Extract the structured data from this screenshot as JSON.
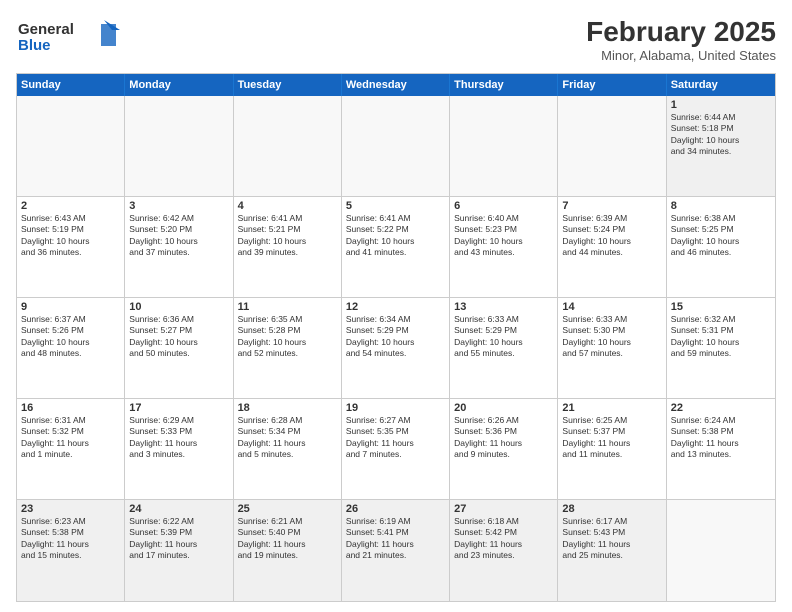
{
  "header": {
    "logo_line1": "General",
    "logo_line2": "Blue",
    "title": "February 2025",
    "subtitle": "Minor, Alabama, United States"
  },
  "days_of_week": [
    "Sunday",
    "Monday",
    "Tuesday",
    "Wednesday",
    "Thursday",
    "Friday",
    "Saturday"
  ],
  "weeks": [
    [
      {
        "day": "",
        "info": ""
      },
      {
        "day": "",
        "info": ""
      },
      {
        "day": "",
        "info": ""
      },
      {
        "day": "",
        "info": ""
      },
      {
        "day": "",
        "info": ""
      },
      {
        "day": "",
        "info": ""
      },
      {
        "day": "1",
        "info": "Sunrise: 6:44 AM\nSunset: 5:18 PM\nDaylight: 10 hours\nand 34 minutes."
      }
    ],
    [
      {
        "day": "2",
        "info": "Sunrise: 6:43 AM\nSunset: 5:19 PM\nDaylight: 10 hours\nand 36 minutes."
      },
      {
        "day": "3",
        "info": "Sunrise: 6:42 AM\nSunset: 5:20 PM\nDaylight: 10 hours\nand 37 minutes."
      },
      {
        "day": "4",
        "info": "Sunrise: 6:41 AM\nSunset: 5:21 PM\nDaylight: 10 hours\nand 39 minutes."
      },
      {
        "day": "5",
        "info": "Sunrise: 6:41 AM\nSunset: 5:22 PM\nDaylight: 10 hours\nand 41 minutes."
      },
      {
        "day": "6",
        "info": "Sunrise: 6:40 AM\nSunset: 5:23 PM\nDaylight: 10 hours\nand 43 minutes."
      },
      {
        "day": "7",
        "info": "Sunrise: 6:39 AM\nSunset: 5:24 PM\nDaylight: 10 hours\nand 44 minutes."
      },
      {
        "day": "8",
        "info": "Sunrise: 6:38 AM\nSunset: 5:25 PM\nDaylight: 10 hours\nand 46 minutes."
      }
    ],
    [
      {
        "day": "9",
        "info": "Sunrise: 6:37 AM\nSunset: 5:26 PM\nDaylight: 10 hours\nand 48 minutes."
      },
      {
        "day": "10",
        "info": "Sunrise: 6:36 AM\nSunset: 5:27 PM\nDaylight: 10 hours\nand 50 minutes."
      },
      {
        "day": "11",
        "info": "Sunrise: 6:35 AM\nSunset: 5:28 PM\nDaylight: 10 hours\nand 52 minutes."
      },
      {
        "day": "12",
        "info": "Sunrise: 6:34 AM\nSunset: 5:29 PM\nDaylight: 10 hours\nand 54 minutes."
      },
      {
        "day": "13",
        "info": "Sunrise: 6:33 AM\nSunset: 5:29 PM\nDaylight: 10 hours\nand 55 minutes."
      },
      {
        "day": "14",
        "info": "Sunrise: 6:33 AM\nSunset: 5:30 PM\nDaylight: 10 hours\nand 57 minutes."
      },
      {
        "day": "15",
        "info": "Sunrise: 6:32 AM\nSunset: 5:31 PM\nDaylight: 10 hours\nand 59 minutes."
      }
    ],
    [
      {
        "day": "16",
        "info": "Sunrise: 6:31 AM\nSunset: 5:32 PM\nDaylight: 11 hours\nand 1 minute."
      },
      {
        "day": "17",
        "info": "Sunrise: 6:29 AM\nSunset: 5:33 PM\nDaylight: 11 hours\nand 3 minutes."
      },
      {
        "day": "18",
        "info": "Sunrise: 6:28 AM\nSunset: 5:34 PM\nDaylight: 11 hours\nand 5 minutes."
      },
      {
        "day": "19",
        "info": "Sunrise: 6:27 AM\nSunset: 5:35 PM\nDaylight: 11 hours\nand 7 minutes."
      },
      {
        "day": "20",
        "info": "Sunrise: 6:26 AM\nSunset: 5:36 PM\nDaylight: 11 hours\nand 9 minutes."
      },
      {
        "day": "21",
        "info": "Sunrise: 6:25 AM\nSunset: 5:37 PM\nDaylight: 11 hours\nand 11 minutes."
      },
      {
        "day": "22",
        "info": "Sunrise: 6:24 AM\nSunset: 5:38 PM\nDaylight: 11 hours\nand 13 minutes."
      }
    ],
    [
      {
        "day": "23",
        "info": "Sunrise: 6:23 AM\nSunset: 5:38 PM\nDaylight: 11 hours\nand 15 minutes."
      },
      {
        "day": "24",
        "info": "Sunrise: 6:22 AM\nSunset: 5:39 PM\nDaylight: 11 hours\nand 17 minutes."
      },
      {
        "day": "25",
        "info": "Sunrise: 6:21 AM\nSunset: 5:40 PM\nDaylight: 11 hours\nand 19 minutes."
      },
      {
        "day": "26",
        "info": "Sunrise: 6:19 AM\nSunset: 5:41 PM\nDaylight: 11 hours\nand 21 minutes."
      },
      {
        "day": "27",
        "info": "Sunrise: 6:18 AM\nSunset: 5:42 PM\nDaylight: 11 hours\nand 23 minutes."
      },
      {
        "day": "28",
        "info": "Sunrise: 6:17 AM\nSunset: 5:43 PM\nDaylight: 11 hours\nand 25 minutes."
      },
      {
        "day": "",
        "info": ""
      }
    ]
  ]
}
